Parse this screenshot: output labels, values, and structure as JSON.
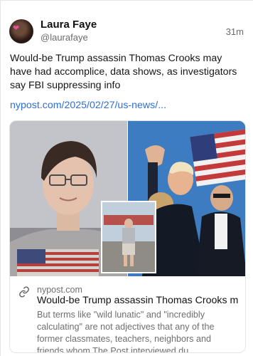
{
  "post": {
    "author_name": "Laura Faye",
    "author_handle": "@laurafaye",
    "time": "31m",
    "text": "Would-be Trump assassin Thomas Crooks may have had accomplice, data shows, as investigators say FBI suppressing info",
    "link_text": "nypost.com/2025/02/27/us-news/..."
  },
  "preview": {
    "domain": "nypost.com",
    "title": "Would-be Trump assassin Thomas Crooks may...",
    "description": "But terms like \"wild lunatic\" and \"incredibly calculating\" are not adjectives that any of the former classmates, teachers, neighbors and friends whom The Post interviewed du..."
  },
  "colors": {
    "link": "#2f6fd6",
    "muted": "#6b6b6b"
  },
  "icons": {
    "link": "link-icon"
  }
}
